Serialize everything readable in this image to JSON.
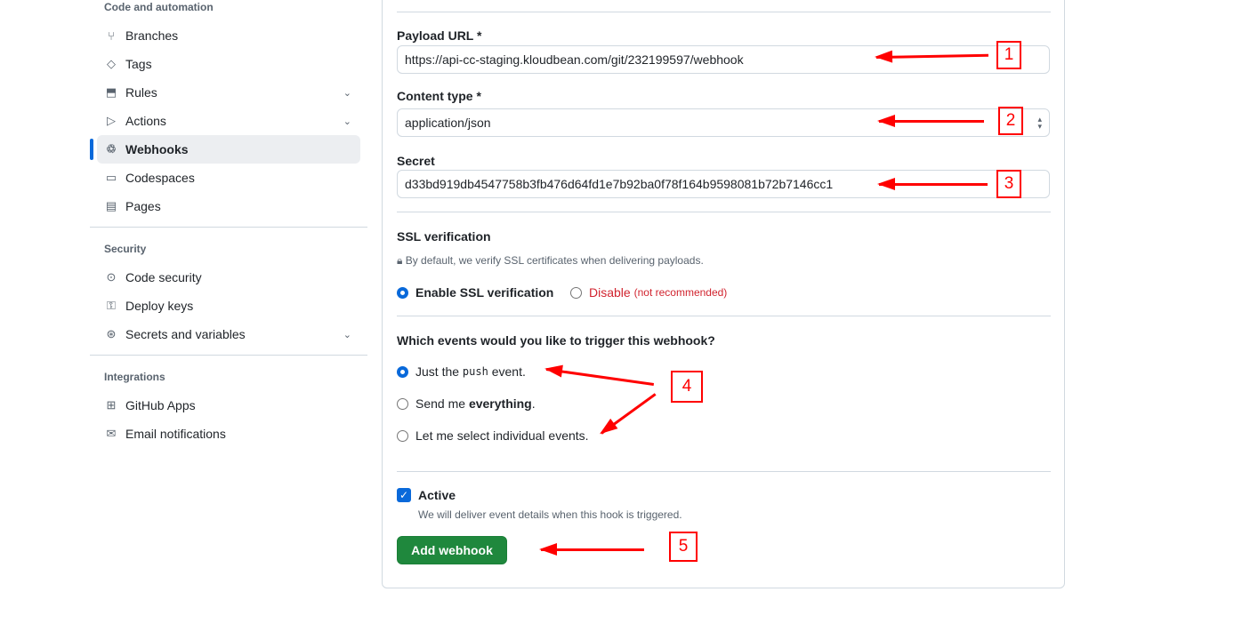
{
  "sidebar": {
    "sections": [
      {
        "title": "Code and automation",
        "items": [
          {
            "label": "Branches",
            "icon": "git-branch-icon"
          },
          {
            "label": "Tags",
            "icon": "tag-icon"
          },
          {
            "label": "Rules",
            "icon": "rules-icon"
          },
          {
            "label": "Actions",
            "icon": "play-icon"
          },
          {
            "label": "Webhooks",
            "icon": "webhook-icon"
          },
          {
            "label": "Codespaces",
            "icon": "codespaces-icon"
          },
          {
            "label": "Pages",
            "icon": "browser-icon"
          }
        ]
      },
      {
        "title": "Security",
        "items": [
          {
            "label": "Code security",
            "icon": "codescan-icon"
          },
          {
            "label": "Deploy keys",
            "icon": "key-icon"
          },
          {
            "label": "Secrets and variables",
            "icon": "asterisk-icon"
          }
        ]
      },
      {
        "title": "Integrations",
        "items": [
          {
            "label": "GitHub Apps",
            "icon": "apps-icon"
          },
          {
            "label": "Email notifications",
            "icon": "mail-icon"
          }
        ]
      }
    ]
  },
  "form": {
    "payload_label": "Payload URL *",
    "payload_value": "https://api-cc-staging.kloudbean.com/git/232199597/webhook",
    "content_label": "Content type *",
    "content_value": "application/json",
    "secret_label": "Secret",
    "secret_value": "d33bd919db4547758b3fb476d64fd1e7b92ba0f78f164b9598081b72b7146cc1",
    "ssl_title": "SSL verification",
    "ssl_note": "By default, we verify SSL certificates when delivering payloads.",
    "ssl_enable": "Enable SSL verification",
    "ssl_disable": "Disable",
    "ssl_disable_note": "(not recommended)",
    "events_title": "Which events would you like to trigger this webhook?",
    "ev_push_a": "Just the ",
    "ev_push_code": "push",
    "ev_push_b": " event.",
    "ev_all_a": "Send me ",
    "ev_all_b": "everything",
    "ev_all_c": ".",
    "ev_select": "Let me select individual events.",
    "active_label": "Active",
    "active_note": "We will deliver event details when this hook is triggered.",
    "submit": "Add webhook"
  },
  "annotations": [
    "1",
    "2",
    "3",
    "4",
    "5"
  ],
  "colors": {
    "accent": "#0969da",
    "danger": "#d1242f",
    "button": "#1f883d",
    "annotation": "#ff0000"
  }
}
